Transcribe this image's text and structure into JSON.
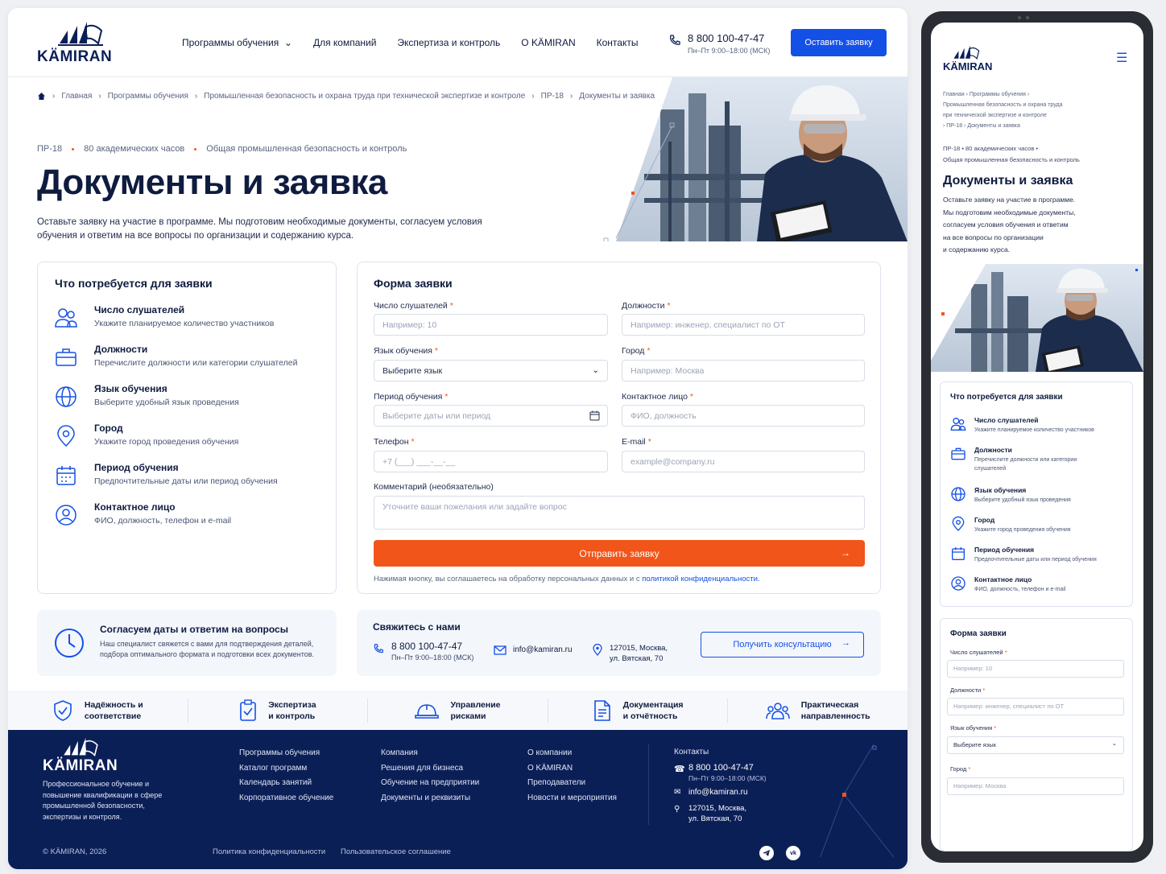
{
  "brand": {
    "name": "KÄMIRAN"
  },
  "nav": {
    "items": [
      "Программы обучения",
      "Для компаний",
      "Экспертиза и контроль",
      "О KÄMIRAN",
      "Контакты"
    ]
  },
  "header": {
    "phone": "8 800 100-47-47",
    "hours": "Пн–Пт 9:00–18:00 (МСК)",
    "cta": "Оставить заявку"
  },
  "breadcrumbs": [
    "Главная",
    "Программы обучения",
    "Промышленная безопасность и охрана труда при технической экспертизе и контроле",
    "ПР-18",
    "Документы и заявка"
  ],
  "meta": {
    "code": "ПР-18",
    "hours": "80 академических часов",
    "category": "Общая промышленная безопасность и контроль"
  },
  "page": {
    "title": "Документы и заявка",
    "lead": "Оставьте заявку на участие в программе. Мы подготовим необходимые документы, согласуем условия обучения и ответим на все вопросы по организации и содержанию курса."
  },
  "requirements": {
    "title": "Что потребуется для заявки",
    "items": [
      {
        "title": "Число слушателей",
        "text": "Укажите планируемое количество участников",
        "icon": "users-icon"
      },
      {
        "title": "Должности",
        "text": "Перечислите должности или категории слушателей",
        "icon": "briefcase-icon"
      },
      {
        "title": "Язык обучения",
        "text": "Выберите удобный язык проведения",
        "icon": "globe-icon"
      },
      {
        "title": "Город",
        "text": "Укажите город проведения обучения",
        "icon": "location-icon"
      },
      {
        "title": "Период обучения",
        "text": "Предпочтительные даты или период обучения",
        "icon": "calendar-icon"
      },
      {
        "title": "Контактное лицо",
        "text": "ФИО, должность, телефон и e-mail",
        "icon": "person-icon"
      }
    ]
  },
  "form": {
    "title": "Форма заявки",
    "fields": {
      "listeners": {
        "label": "Число слушателей",
        "placeholder": "Например: 10"
      },
      "positions": {
        "label": "Должности",
        "placeholder": "Например: инженер, специалист по ОТ"
      },
      "language": {
        "label": "Язык обучения",
        "value": "Выберите язык"
      },
      "city": {
        "label": "Город",
        "placeholder": "Например: Москва"
      },
      "period": {
        "label": "Период обучения",
        "placeholder": "Выберите даты или период"
      },
      "contact": {
        "label": "Контактное лицо",
        "placeholder": "ФИО, должность"
      },
      "phone": {
        "label": "Телефон",
        "placeholder": "+7 (___) ___-__-__"
      },
      "email": {
        "label": "E-mail",
        "placeholder": "example@company.ru"
      },
      "comment": {
        "label": "Комментарий (необязательно)",
        "placeholder": "Уточните ваши пожелания или задайте вопрос"
      }
    },
    "required_mark": "*",
    "submit": "Отправить заявку",
    "consent": "Нажимая кнопку, вы соглашаетесь на обработку персональных данных и с",
    "consent_link": "политикой конфиденциальности."
  },
  "agree": {
    "title": "Согласуем даты и ответим на вопросы",
    "text": "Наш специалист свяжется с вами для подтверждения деталей, подбора оптимального формата и подготовки всех документов."
  },
  "contact": {
    "title": "Свяжитесь с нами",
    "phone": "8 800 100-47-47",
    "hours": "Пн–Пт 9:00–18:00 (МСК)",
    "email": "info@kamiran.ru",
    "address1": "127015, Москва,",
    "address2": "ул. Вятская, 70",
    "cta": "Получить консультацию"
  },
  "features": [
    {
      "l1": "Надёжность и",
      "l2": "соответствие",
      "icon": "shield-icon"
    },
    {
      "l1": "Экспертиза",
      "l2": "и контроль",
      "icon": "clipboard-icon"
    },
    {
      "l1": "Управление",
      "l2": "рисками",
      "icon": "helmet-icon"
    },
    {
      "l1": "Документация",
      "l2": "и отчётность",
      "icon": "document-icon"
    },
    {
      "l1": "Практическая",
      "l2": "направленность",
      "icon": "team-icon"
    }
  ],
  "footer": {
    "about": "Профессиональное обучение и повышение квалификации в сфере промышленной безопасности, экспертизы и контроля.",
    "col1": [
      "Программы обучения",
      "Каталог программ",
      "Календарь занятий",
      "Корпоративное обучение"
    ],
    "col2": [
      "Компания",
      "Решения для бизнеса",
      "Обучение на предприятии",
      "Документы и реквизиты"
    ],
    "col3": [
      "О компании",
      "О KÄMIRAN",
      "Преподаватели",
      "Новости и мероприятия"
    ],
    "contacts_title": "Контакты",
    "phone": "8 800 100-47-47",
    "hours": "Пн–Пт 9:00–18:00 (МСК)",
    "email": "info@kamiran.ru",
    "address1": "127015, Москва,",
    "address2": "ул. Вятская, 70",
    "copyright": "© KÄMIRAN, 2026",
    "privacy": "Политика конфиденциальности",
    "terms": "Пользовательское соглашение"
  },
  "mobile": {
    "crumb_l1": "Главная  ›  Программы обучения  ›",
    "crumb_l2": "Промышленная безопасность и охрана труда",
    "crumb_l3": "при технической экспертизе и контроле",
    "crumb_l4": "›  ПР-18  ›  Документы и заявка",
    "meta1": "ПР-18  •  80 академических часов  •",
    "meta2": "Общая промышленная безопасность и контроль",
    "lead_lines": [
      "Оставьте заявку на участие в программе.",
      "Мы подготовим необходимые документы,",
      "согласуем условия обучения и ответим",
      "на все вопросы по организации",
      "и содержанию курса."
    ],
    "req_items": [
      {
        "title": "Число слушателей",
        "l1": "Укажите планируемое количество участников",
        "l2": ""
      },
      {
        "title": "Должности",
        "l1": "Перечислите должности или категории",
        "l2": "слушателей"
      },
      {
        "title": "Язык обучения",
        "l1": "Выберите удобный язык проведения",
        "l2": ""
      },
      {
        "title": "Город",
        "l1": "Укажите город проведения обучения",
        "l2": ""
      },
      {
        "title": "Период обучения",
        "l1": "Предпочтительные даты или период обучения",
        "l2": ""
      },
      {
        "title": "Контактное лицо",
        "l1": "ФИО, должность, телефон и e-mail",
        "l2": ""
      }
    ]
  },
  "colors": {
    "navy": "#0b1f57",
    "blue": "#1550e6",
    "orange": "#f2551a"
  }
}
